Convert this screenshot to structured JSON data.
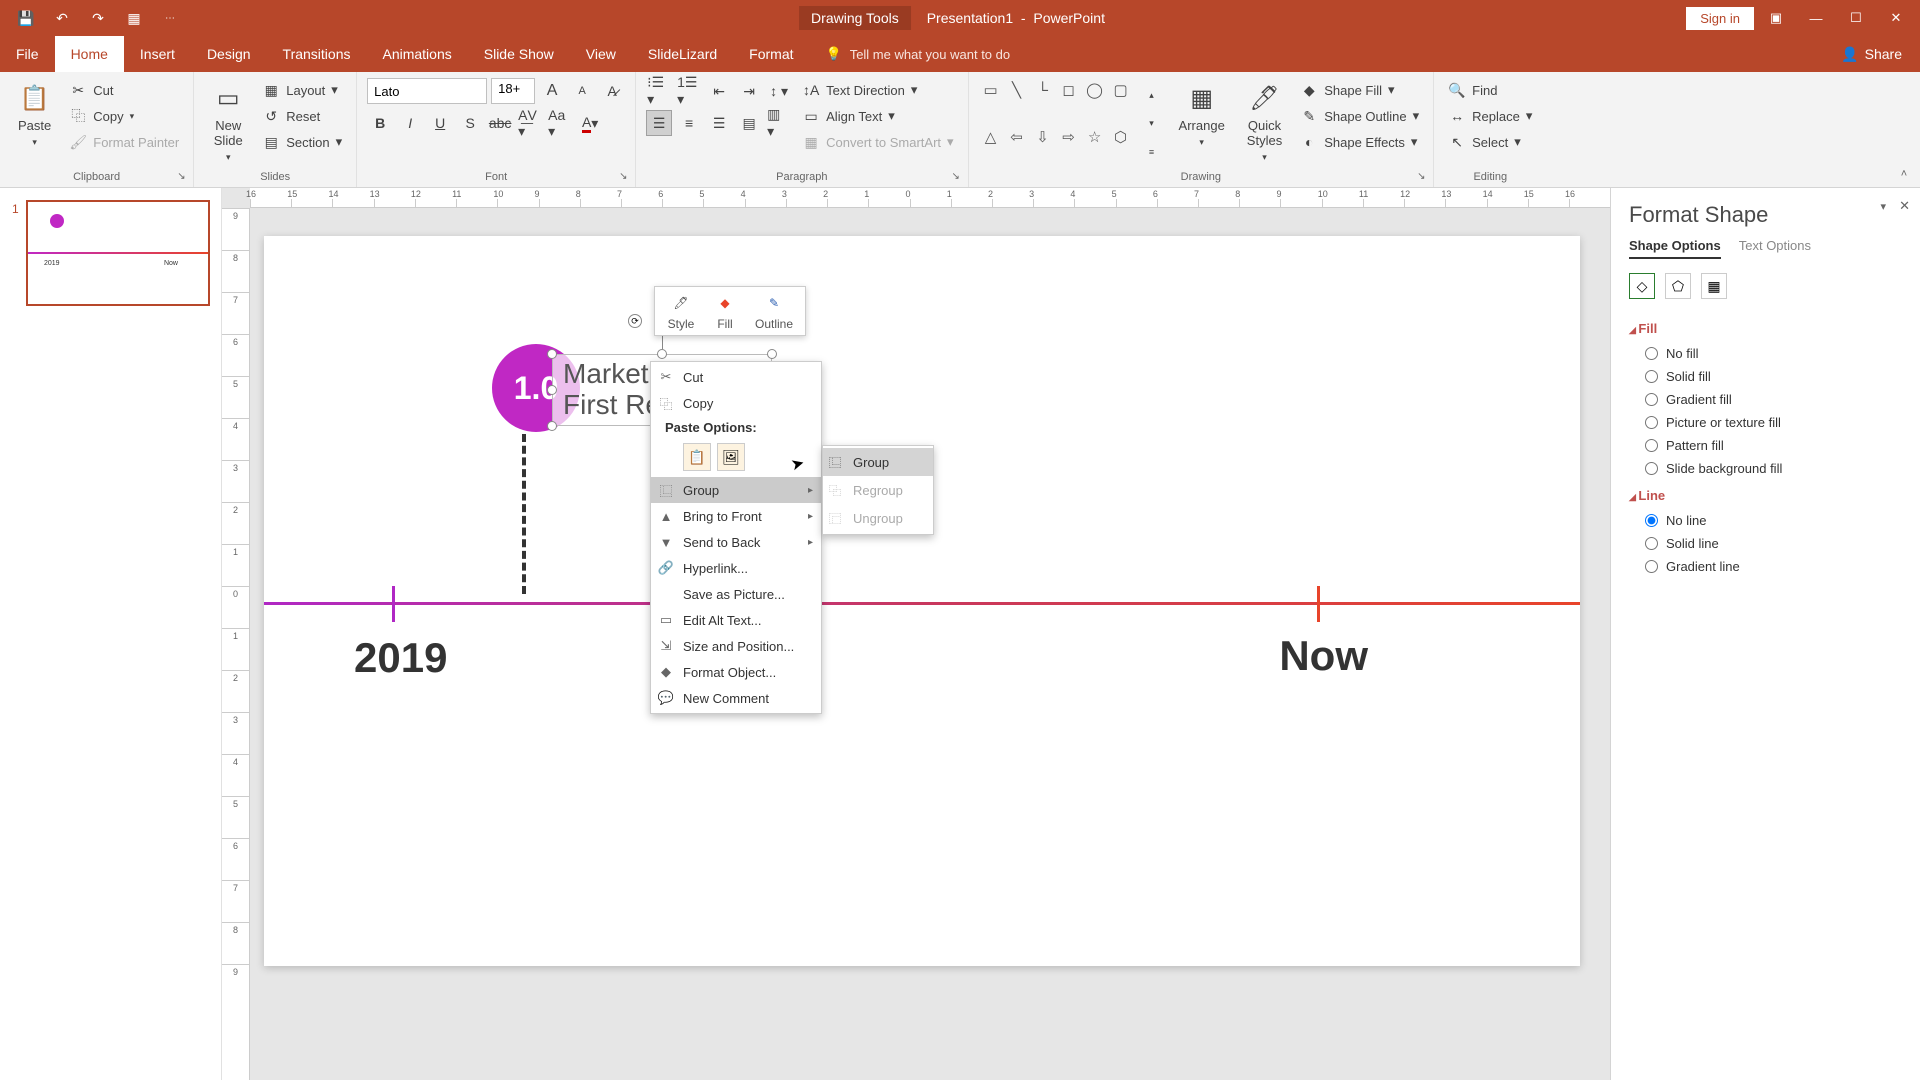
{
  "title": {
    "tools": "Drawing Tools",
    "doc": "Presentation1",
    "app": "PowerPoint",
    "signin": "Sign in"
  },
  "tabs": {
    "file": "File",
    "home": "Home",
    "insert": "Insert",
    "design": "Design",
    "transitions": "Transitions",
    "animations": "Animations",
    "slideshow": "Slide Show",
    "view": "View",
    "slidelizard": "SlideLizard",
    "format": "Format",
    "tellme": "Tell me what you want to do",
    "share": "Share"
  },
  "ribbon": {
    "clipboard": {
      "label": "Clipboard",
      "paste": "Paste",
      "cut": "Cut",
      "copy": "Copy",
      "painter": "Format Painter"
    },
    "slides": {
      "label": "Slides",
      "new": "New\nSlide",
      "layout": "Layout",
      "reset": "Reset",
      "section": "Section"
    },
    "font": {
      "label": "Font",
      "name": "Lato",
      "size": "18+"
    },
    "paragraph": {
      "label": "Paragraph",
      "textdir": "Text Direction",
      "align": "Align Text",
      "smartart": "Convert to SmartArt"
    },
    "drawing": {
      "label": "Drawing",
      "arrange": "Arrange",
      "quick": "Quick\nStyles",
      "fill": "Shape Fill",
      "outline": "Shape Outline",
      "effects": "Shape Effects"
    },
    "editing": {
      "label": "Editing",
      "find": "Find",
      "replace": "Replace",
      "select": "Select"
    }
  },
  "pane_label": "1",
  "slide": {
    "milestone": "1.0",
    "txt1": "Market La",
    "txt2": "First Relea",
    "year1": "2019",
    "year2": "Now"
  },
  "minitb": {
    "style": "Style",
    "fill": "Fill",
    "outline": "Outline"
  },
  "ctx": {
    "cut": "Cut",
    "copy": "Copy",
    "paste_label": "Paste Options:",
    "group": "Group",
    "front": "Bring to Front",
    "back": "Send to Back",
    "hyperlink": "Hyperlink...",
    "savepic": "Save as Picture...",
    "alttext": "Edit Alt Text...",
    "sizepos": "Size and Position...",
    "formatobj": "Format Object...",
    "newcomment": "New Comment"
  },
  "sub": {
    "group": "Group",
    "regroup": "Regroup",
    "ungroup": "Ungroup"
  },
  "pane": {
    "title": "Format Shape",
    "tab_shape": "Shape Options",
    "tab_text": "Text Options",
    "fill_label": "Fill",
    "nofill": "No fill",
    "solidfill": "Solid fill",
    "gradfill": "Gradient fill",
    "picfill": "Picture or texture fill",
    "patfill": "Pattern fill",
    "bgfill": "Slide background fill",
    "line_label": "Line",
    "noline": "No line",
    "solidline": "Solid line",
    "gradline": "Gradient line"
  }
}
